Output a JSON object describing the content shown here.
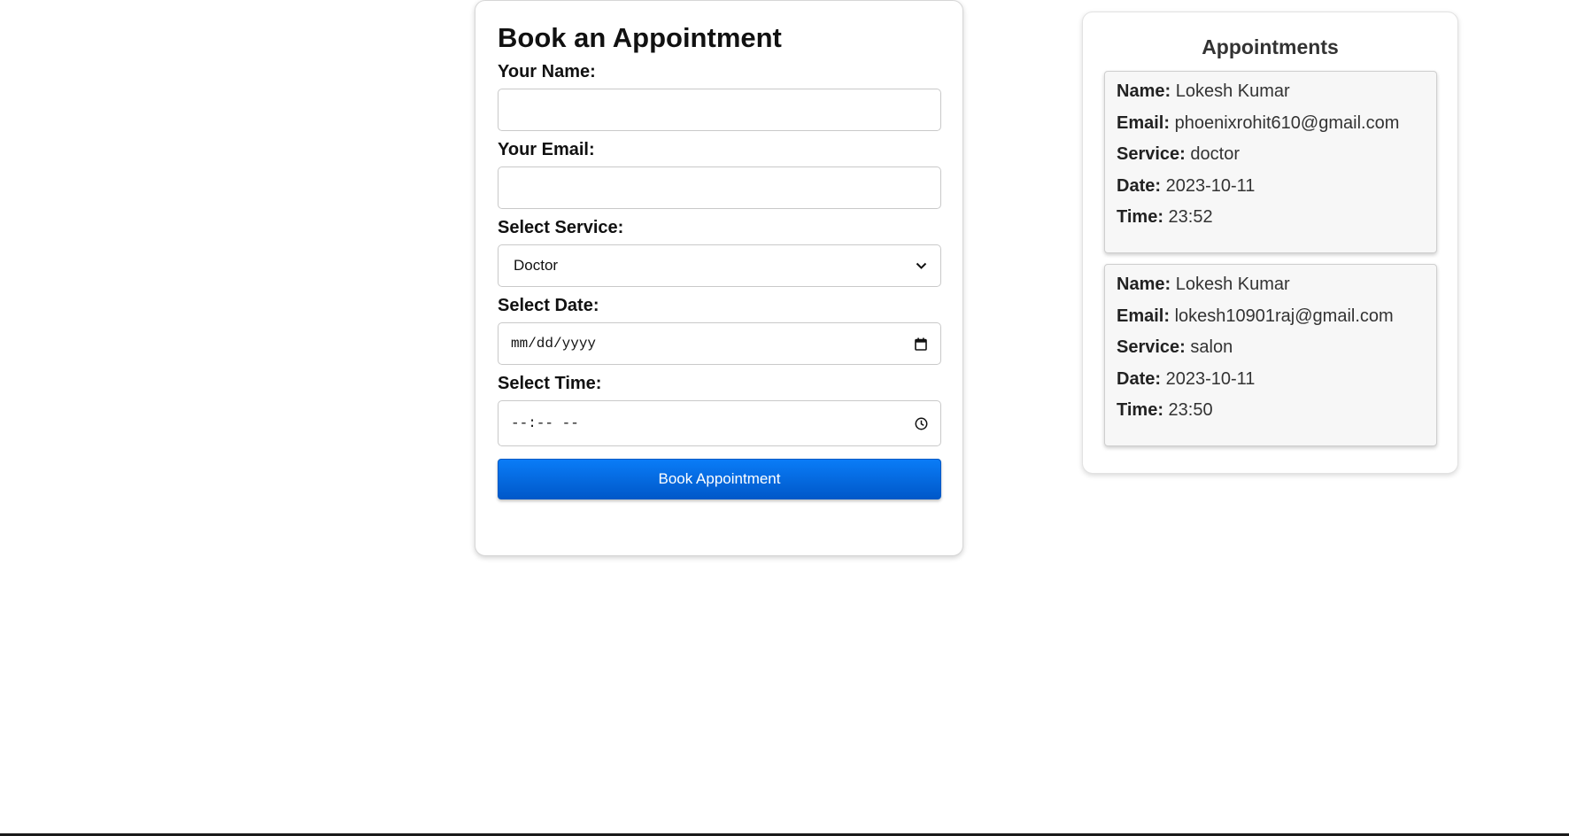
{
  "form": {
    "title": "Book an Appointment",
    "name_label": "Your Name:",
    "name_value": "",
    "email_label": "Your Email:",
    "email_value": "",
    "service_label": "Select Service:",
    "service_selected": "Doctor",
    "date_label": "Select Date:",
    "date_placeholder": "mm/dd/yyyy",
    "time_label": "Select Time:",
    "time_placeholder": "--:-- --",
    "submit_label": "Book Appointment",
    "accent_color": "#0a6fe8"
  },
  "appointments": {
    "title": "Appointments",
    "field_labels": {
      "name": "Name:",
      "email": "Email:",
      "service": "Service:",
      "date": "Date:",
      "time": "Time:"
    },
    "items": [
      {
        "name": "Lokesh Kumar",
        "email": "phoenixrohit610@gmail.com",
        "service": "doctor",
        "date": "2023-10-11",
        "time": "23:52"
      },
      {
        "name": "Lokesh Kumar",
        "email": "lokesh10901raj@gmail.com",
        "service": "salon",
        "date": "2023-10-11",
        "time": "23:50"
      }
    ]
  },
  "icons": {
    "service_dropdown": "chevron-down-icon",
    "date_picker": "calendar-icon",
    "time_picker": "clock-icon"
  }
}
